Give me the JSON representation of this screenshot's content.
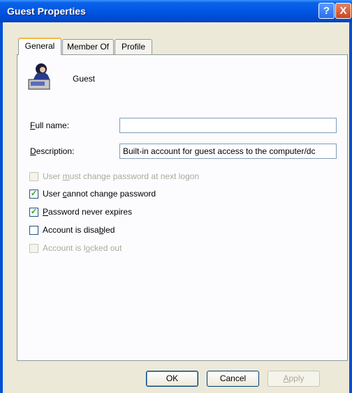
{
  "window": {
    "title": "Guest Properties"
  },
  "titlebar": {
    "help_glyph": "?",
    "close_glyph": "X"
  },
  "tabs": [
    {
      "label": "General",
      "active": true
    },
    {
      "label": "Member Of",
      "active": false
    },
    {
      "label": "Profile",
      "active": false
    }
  ],
  "general": {
    "username": "Guest",
    "full_name": {
      "label_key": "F",
      "label_rest": "ull name:",
      "value": ""
    },
    "description": {
      "label_key": "D",
      "label_rest": "escription:",
      "value": "Built-in account for guest access to the computer/dc"
    },
    "checkboxes": [
      {
        "pre": "User ",
        "key": "m",
        "post": "ust change password at next logon",
        "checked": false,
        "enabled": false
      },
      {
        "pre": "User ",
        "key": "c",
        "post": "annot change password",
        "checked": true,
        "enabled": true
      },
      {
        "pre": "",
        "key": "P",
        "post": "assword never expires",
        "checked": true,
        "enabled": true
      },
      {
        "pre": "Account is disa",
        "key": "b",
        "post": "led",
        "checked": false,
        "enabled": true
      },
      {
        "pre": "Account is l",
        "key": "o",
        "post": "cked out",
        "checked": false,
        "enabled": false
      }
    ]
  },
  "buttons": {
    "ok": "OK",
    "cancel": "Cancel",
    "apply_key": "A",
    "apply_rest": "pply"
  },
  "icons": {
    "user": "user-account-icon",
    "check": "checkmark-icon",
    "help": "help-icon",
    "close": "close-icon"
  },
  "colors": {
    "titlebar": "#0054e3",
    "tab_highlight": "#f7b540",
    "check": "#21a121"
  }
}
